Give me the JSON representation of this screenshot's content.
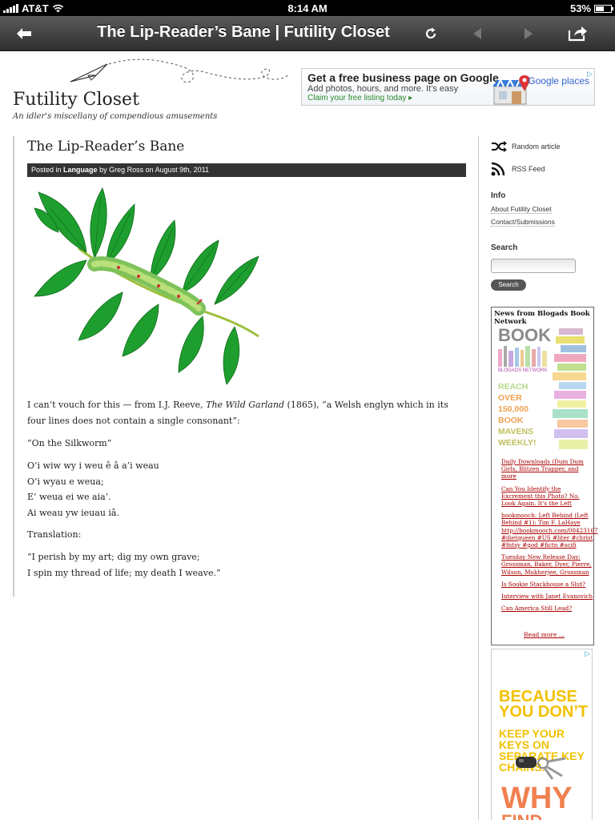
{
  "status_bar": {
    "carrier": "AT&T",
    "time": "8:14 AM",
    "battery": "53%"
  },
  "browser": {
    "title": "The Lip-Reader’s Bane | Futility Closet",
    "icons": {
      "back": "back-arrow-icon",
      "reload": "reload-icon",
      "prev": "previous-page-icon",
      "next": "next-page-icon",
      "share": "share-icon"
    }
  },
  "site": {
    "title": "Futility Closet",
    "tagline": "An idler's miscellany of compendious amusements"
  },
  "ad_top": {
    "headline": "Get a free business page on Google",
    "subline": "Add photos, hours, and more. It’s easy",
    "cta": "Claim your free listing today ▸",
    "brand": "Google places"
  },
  "post": {
    "title": "The Lip-Reader’s Bane",
    "meta": {
      "posted_in": "Posted in",
      "category": "Language",
      "by": "by Greg Ross on August 9th, 2011"
    },
    "intro_before": "I can’t vouch for this — from I.J. Reeve,",
    "intro_italic": "The Wild Garland",
    "intro_after": "(1865), “a Welsh englyn which in its four lines does not contain a single consonant”:",
    "poem_title": "“On the Silkworm”",
    "poem_lines": [
      "O’i wiw wy i weu ê â a’i weau",
      "O’i wyau e weua;",
      "E’ weua ei we aia’.",
      "Ai weau yw ieuau iâ."
    ],
    "translation_label": "Translation:",
    "translation_lines": [
      "“I perish by my art; dig my own grave;",
      "I spin my thread of life; my death I weave.”"
    ]
  },
  "sidebar": {
    "random": "Random article",
    "rss": "RSS Feed",
    "info_heading": "Info",
    "info_links": [
      "About Futility Closet",
      "Contact/Submissions"
    ],
    "search_heading": "Search",
    "search_button": "Search",
    "network": {
      "heading": "News from Blogads Book Network",
      "ad_big": "BOOK",
      "ad_sub": "BLOGADS NETWORK",
      "ad_lines": [
        "REACH",
        "OVER",
        "150,000",
        "BOOK",
        "MAVENS",
        "WEEKLY!"
      ],
      "links": [
        "Daily Downloads (Dum Dum Girls, Blitzen Trapper, and more",
        "Can You Identify the Excrement this Photo? No. Look Again. It's the Left",
        "bookmooch: Left Behind (Left Behind #1): Tim F. LaHaye http://bookmooch.com/08423167 #dietqueen #US #liter #christ #fntsy #god #fictn #scifi",
        "Tuesday New Release Day: Grossman, Baker, Dyer, Pierre, Wilson, Mukherjee, Grossman",
        "Is Sookie Stackhouse a Slut?",
        "Interview with Janet Evanovich",
        "Can America Still Lead?"
      ],
      "read_more": "Read more ..."
    },
    "bottom_ad": {
      "line1": "BECAUSE YOU DON’T",
      "line2": "KEEP YOUR KEYS ON SEPARATE KEY CHAINS.",
      "line3": "WHY",
      "line4": "FIND YOUR"
    }
  },
  "colors": {
    "meta_bar": "#333333",
    "link_red": "#aa0000",
    "leaf_green": "#1e9e2e",
    "ad_yellow": "#f2c100",
    "ad_orange": "#f08050"
  }
}
